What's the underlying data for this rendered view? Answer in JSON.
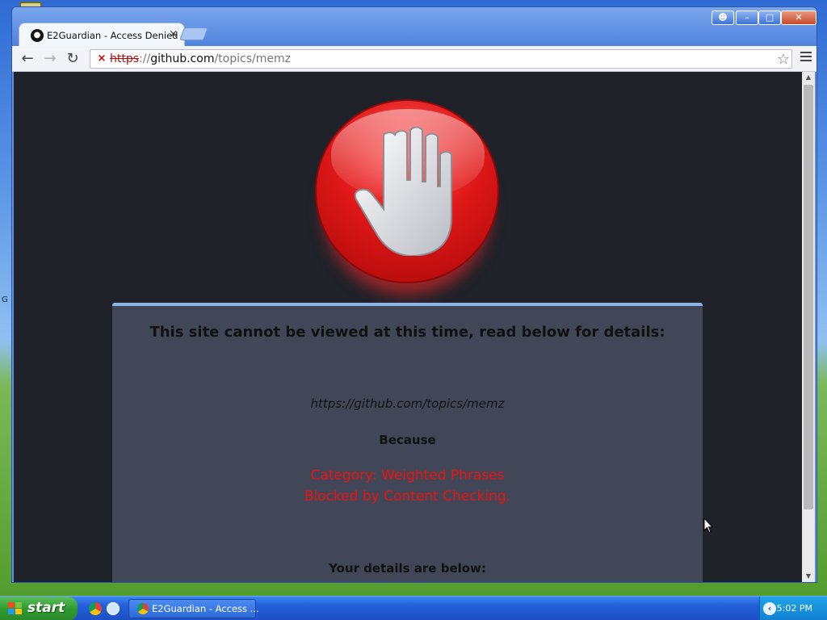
{
  "window": {
    "tab_title": "E2Guardian - Access Denied",
    "tab_close": "×"
  },
  "toolbar": {
    "url_scheme": "https",
    "url_sep": "://",
    "url_host": "github.com",
    "url_path": "/topics/memz"
  },
  "page": {
    "heading": "This site cannot be viewed at this time, read below for details:",
    "blocked_url": "https://github.com/topics/memz",
    "because_label": "Because",
    "reason_category": "Category: Weighted Phrases",
    "reason_detail": "Blocked by Content Checking.",
    "details_label": "Your details are below:"
  },
  "taskbar": {
    "start_label": "start",
    "task_button_label": "E2Guardian - Access ...",
    "clock": "5:02 PM"
  },
  "colors": {
    "reason_text": "#ee1111",
    "page_background": "#1f2229",
    "panel_background": "#414756"
  },
  "icons": [
    "back-arrow-icon",
    "forward-arrow-icon",
    "reload-icon",
    "insecure-lock-icon",
    "bookmark-star-icon",
    "menu-icon",
    "stop-hand-icon",
    "github-favicon-icon",
    "chrome-icon"
  ]
}
